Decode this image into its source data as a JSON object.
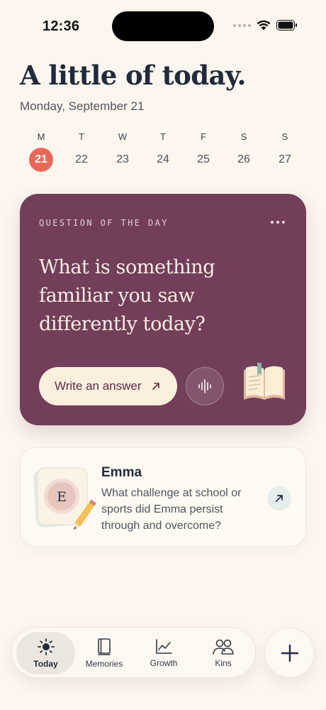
{
  "status_bar": {
    "time": "12:36"
  },
  "header": {
    "title": "A little of today.",
    "date": "Monday, September 21"
  },
  "week": [
    {
      "letter": "M",
      "num": "21",
      "active": true
    },
    {
      "letter": "T",
      "num": "22",
      "active": false
    },
    {
      "letter": "W",
      "num": "23",
      "active": false
    },
    {
      "letter": "T",
      "num": "24",
      "active": false
    },
    {
      "letter": "F",
      "num": "25",
      "active": false
    },
    {
      "letter": "S",
      "num": "26",
      "active": false
    },
    {
      "letter": "S",
      "num": "27",
      "active": false
    }
  ],
  "question_card": {
    "eyebrow": "QUESTION OF THE DAY",
    "question": "What is something familiar you saw differently today?",
    "write_label": "Write an answer",
    "more_icon": "more-horizontal-icon",
    "voice_icon": "waveform-icon",
    "color": "#723e59"
  },
  "kin_card": {
    "initial": "E",
    "name": "Emma",
    "question": "What challenge at school or sports did Emma persist through and overcome?"
  },
  "tabs": [
    {
      "label": "Today",
      "icon": "sun-icon",
      "active": true
    },
    {
      "label": "Memories",
      "icon": "book-icon",
      "active": false
    },
    {
      "label": "Growth",
      "icon": "chart-icon",
      "active": false
    },
    {
      "label": "Kins",
      "icon": "people-icon",
      "active": false
    }
  ],
  "fab": {
    "icon": "plus-icon"
  },
  "colors": {
    "accent": "#e8695a",
    "background": "#fcf6ee",
    "card": "#723e59"
  }
}
